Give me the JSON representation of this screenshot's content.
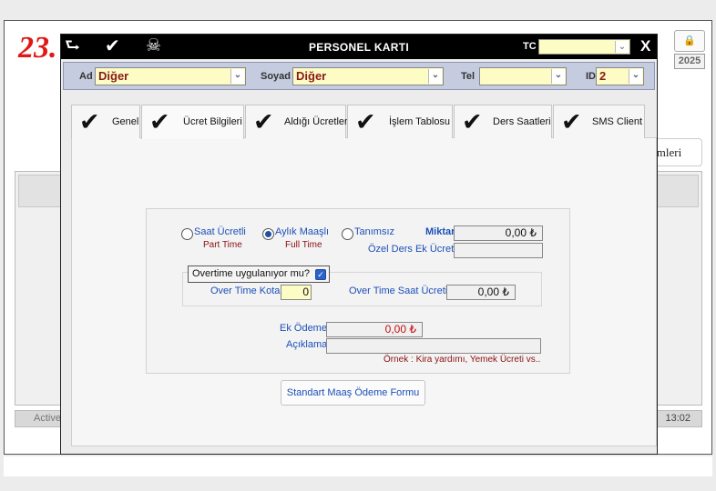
{
  "background": {
    "number": "23.",
    "lock_icon": "lock-icon",
    "year": "2025",
    "islemleri_label": "emleri",
    "status_left": "Active",
    "status_time": "13:02"
  },
  "titlebar": {
    "title": "PERSONEL KARTI",
    "tc_label": "TC",
    "tc_value": "",
    "close_label": "X",
    "icons": [
      "back-arrow-icon",
      "check-icon",
      "skull-icon"
    ]
  },
  "filter": {
    "ad_label": "Ad",
    "ad_value": "Diğer",
    "soyad_label": "Soyad",
    "soyad_value": "Diğer",
    "tel_label": "Tel",
    "tel_value": "",
    "id_label": "ID",
    "id_value": "2"
  },
  "tabs": [
    {
      "label": "Genel",
      "active": false
    },
    {
      "label": "Ücret Bilgileri",
      "active": true
    },
    {
      "label": "Aldığı Ücretler",
      "active": false
    },
    {
      "label": "İşlem Tablosu",
      "active": false
    },
    {
      "label": "Ders Saatleri",
      "active": false
    },
    {
      "label": "SMS Client",
      "active": false
    }
  ],
  "ucret": {
    "radio_saat_label": "Saat Ücretli",
    "radio_saat_sub": "Part Time",
    "radio_aylik_label": "Aylık Maaşlı",
    "radio_aylik_sub": "Full Time",
    "radio_tanimsiz_label": "Tanımsız",
    "selected_radio": "Aylık Maaşlı",
    "miktar_label": "Miktar",
    "miktar_value": "0,00 ₺",
    "ozel_ders_label": "Özel Ders Ek Ücret",
    "ozel_ders_value": "",
    "overtime_check_label": "Overtime uygulanıyor mu?",
    "overtime_checked": true,
    "overtime_kota_label": "Over Time Kota",
    "overtime_kota_value": "0",
    "overtime_saat_label": "Over Time Saat Ücreti",
    "overtime_saat_value": "0,00 ₺",
    "ek_odeme_label": "Ek Ödeme",
    "ek_odeme_value": "0,00 ₺",
    "aciklama_label": "Açıklama",
    "aciklama_value": "",
    "ornek_text": "Örnek : Kira yardımı, Yemek Ücreti vs..",
    "std_button_label": "Standart Maaş Ödeme Formu"
  },
  "colors": {
    "accent_blue": "#1c4fb8",
    "dark_red": "#8a1010",
    "field_yellow": "#fdfcc4",
    "titlebar_bg": "#000000",
    "filter_bg": "#c5cce0"
  }
}
